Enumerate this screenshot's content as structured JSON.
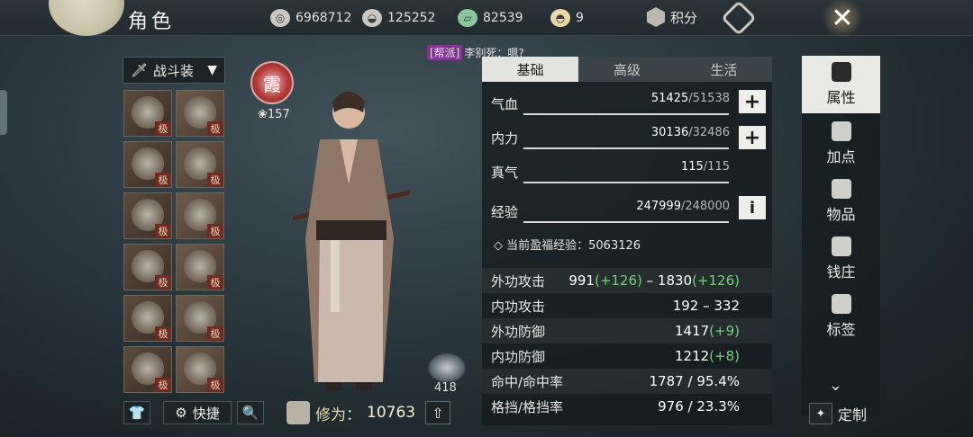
{
  "header": {
    "title": "角色",
    "currencies": [
      {
        "icon": "film-reel-icon",
        "value": "6968712"
      },
      {
        "icon": "silver-ingot-icon",
        "value": "125252"
      },
      {
        "icon": "jade-ticket-icon",
        "value": "82539"
      },
      {
        "icon": "gold-ingot-plus-icon",
        "value": "9"
      }
    ],
    "points_label": "积分"
  },
  "chat": {
    "tag": "[帮派]",
    "message": "李别死：嗯?"
  },
  "equipment": {
    "outfit_label": "战斗装",
    "grade": "极",
    "slots": [
      "weapon-primary",
      "weapon-secondary",
      "head",
      "neck",
      "chest",
      "accessory",
      "belt",
      "bracelet",
      "legs",
      "ring",
      "boots",
      "pouch"
    ],
    "quick_label": "快捷"
  },
  "character": {
    "badge_text": "霞",
    "level": "157",
    "cultivation_label": "修为：",
    "cultivation_value": "10763",
    "pet_count": "418"
  },
  "tabs": [
    "基础",
    "高级",
    "生活"
  ],
  "bars": [
    {
      "label": "气血",
      "current": "51425",
      "max": "/51538",
      "action": "+"
    },
    {
      "label": "内力",
      "current": "30136",
      "max": "/32486",
      "action": "+"
    },
    {
      "label": "真气",
      "current": "115",
      "max": "/115",
      "action": ""
    },
    {
      "label": "经验",
      "current": "247999",
      "max": "/248000",
      "action": "i"
    }
  ],
  "bonus_exp": "◇ 当前盈福经验：5063126",
  "stats": [
    {
      "name": "外功攻击",
      "v1": "991",
      "g1": "(+126)",
      "sep": " – 1830",
      "g2": "(+126)"
    },
    {
      "name": "内功攻击",
      "v1": "192 – 332",
      "g1": "",
      "sep": "",
      "g2": ""
    },
    {
      "name": "外功防御",
      "v1": "1417",
      "g1": "(+9)",
      "sep": "",
      "g2": ""
    },
    {
      "name": "内功防御",
      "v1": "1212",
      "g1": "(+8)",
      "sep": "",
      "g2": ""
    },
    {
      "name": "命中/命中率",
      "v1": "1787 / 95.4%",
      "g1": "",
      "sep": "",
      "g2": ""
    },
    {
      "name": "格挡/格挡率",
      "v1": "976 / 23.3%",
      "g1": "",
      "sep": "",
      "g2": ""
    }
  ],
  "nav": [
    "属性",
    "加点",
    "物品",
    "钱庄",
    "标签"
  ],
  "custom_label": "定制"
}
